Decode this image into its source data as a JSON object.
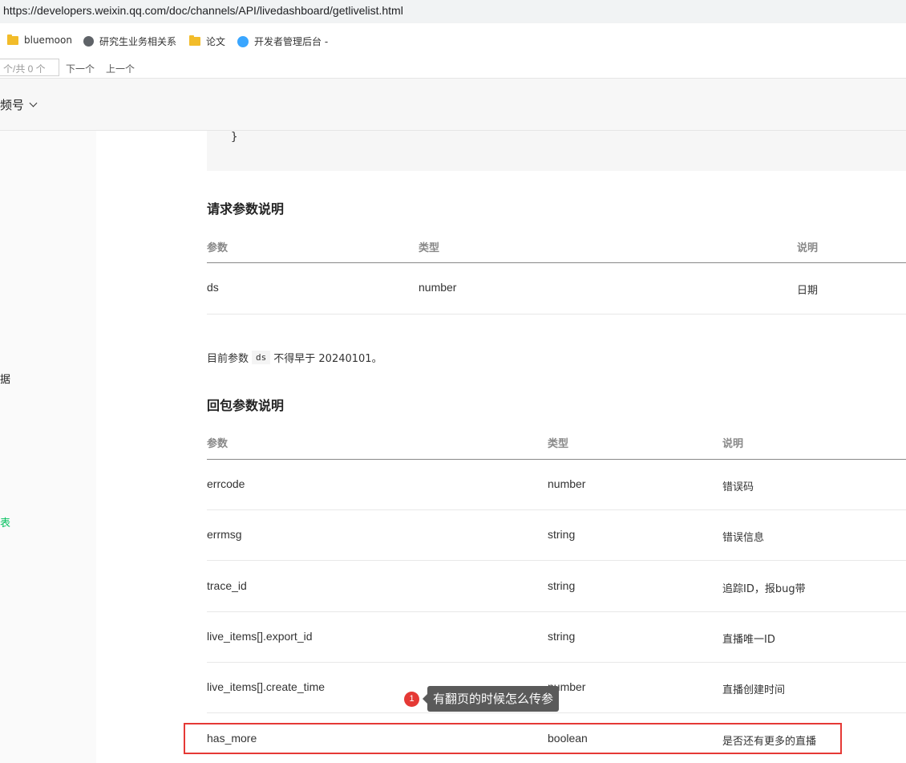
{
  "browser": {
    "url": "https://developers.weixin.qq.com/doc/channels/API/livedashboard/getlivelist.html",
    "bookmarks": [
      {
        "label": "bluemoon",
        "icon": "folder-icon"
      },
      {
        "label": "研究生业务相关系",
        "icon": "globe-icon"
      },
      {
        "label": "论文",
        "icon": "folder-icon"
      },
      {
        "label": "开发者管理后台 -",
        "icon": "devtools-icon"
      }
    ],
    "find": {
      "value": "个/共 0 个",
      "next": "下一个",
      "prev": "上一个"
    }
  },
  "nav": {
    "title": "频号"
  },
  "left": {
    "frag1": "据",
    "frag2": "表"
  },
  "code": {
    "closing": "}"
  },
  "request": {
    "title": "请求参数说明",
    "headers": [
      "参数",
      "类型",
      "说明"
    ],
    "rows": [
      {
        "name": "ds",
        "type": "number",
        "desc": "日期"
      }
    ]
  },
  "note": {
    "prefix": "目前参数",
    "code": "ds",
    "suffix": "不得早于 20240101。"
  },
  "response": {
    "title": "回包参数说明",
    "headers": [
      "参数",
      "类型",
      "说明"
    ],
    "rows": [
      {
        "name": "errcode",
        "type": "number",
        "desc": "错误码"
      },
      {
        "name": "errmsg",
        "type": "string",
        "desc": "错误信息"
      },
      {
        "name": "trace_id",
        "type": "string",
        "desc": "追踪ID，报bug带"
      },
      {
        "name": "live_items[].export_id",
        "type": "string",
        "desc": "直播唯一ID"
      },
      {
        "name": "live_items[].create_time",
        "type": "number",
        "desc": "直播创建时间"
      },
      {
        "name": "has_more",
        "type": "boolean",
        "desc": "是否还有更多的直播"
      }
    ]
  },
  "annotation": {
    "badge": "1",
    "text": "有翻页的时候怎么传参",
    "color": "#e53935"
  }
}
